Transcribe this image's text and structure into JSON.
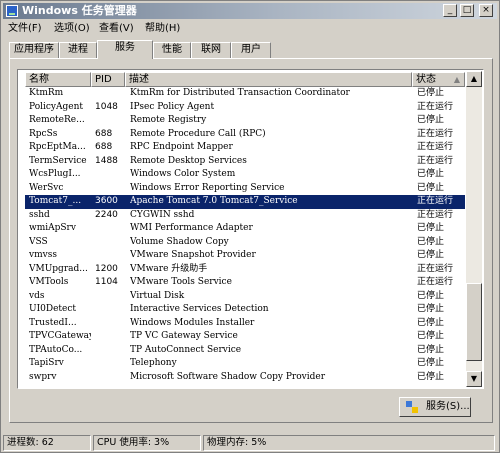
{
  "window": {
    "title": "Windows 任务管理器"
  },
  "titlebar_buttons": {
    "minimize": "_",
    "maximize": "□",
    "close": "×"
  },
  "menu": [
    "文件(F)",
    "选项(O)",
    "查看(V)",
    "帮助(H)"
  ],
  "tabs": [
    "应用程序",
    "进程",
    "服务",
    "性能",
    "联网",
    "用户"
  ],
  "active_tab": "服务",
  "columns": {
    "name": "名称",
    "pid": "PID",
    "desc": "描述",
    "status": "状态"
  },
  "rows": [
    {
      "name": "KtmRm",
      "pid": "",
      "desc": "KtmRm for Distributed Transaction Coordinator",
      "status": "已停止"
    },
    {
      "name": "PolicyAgent",
      "pid": "1048",
      "desc": "IPsec Policy Agent",
      "status": "正在运行"
    },
    {
      "name": "RemoteRe...",
      "pid": "",
      "desc": "Remote Registry",
      "status": "已停止"
    },
    {
      "name": "RpcSs",
      "pid": "688",
      "desc": "Remote Procedure Call (RPC)",
      "status": "正在运行"
    },
    {
      "name": "RpcEptMa...",
      "pid": "688",
      "desc": "RPC Endpoint Mapper",
      "status": "正在运行"
    },
    {
      "name": "TermService",
      "pid": "1488",
      "desc": "Remote Desktop Services",
      "status": "正在运行"
    },
    {
      "name": "WcsPlugI...",
      "pid": "",
      "desc": "Windows Color System",
      "status": "已停止"
    },
    {
      "name": "WerSvc",
      "pid": "",
      "desc": "Windows Error Reporting Service",
      "status": "已停止"
    },
    {
      "name": "Tomcat7_...",
      "pid": "3600",
      "desc": "Apache Tomcat 7.0 Tomcat7_Service",
      "status": "正在运行",
      "selected": true
    },
    {
      "name": "sshd",
      "pid": "2240",
      "desc": "CYGWIN sshd",
      "status": "正在运行"
    },
    {
      "name": "wmiApSrv",
      "pid": "",
      "desc": "WMI Performance Adapter",
      "status": "已停止"
    },
    {
      "name": "VSS",
      "pid": "",
      "desc": "Volume Shadow Copy",
      "status": "已停止"
    },
    {
      "name": "vmvss",
      "pid": "",
      "desc": "VMware Snapshot Provider",
      "status": "已停止"
    },
    {
      "name": "VMUpgrad...",
      "pid": "1200",
      "desc": "VMware 升级助手",
      "status": "正在运行"
    },
    {
      "name": "VMTools",
      "pid": "1104",
      "desc": "VMware Tools Service",
      "status": "正在运行"
    },
    {
      "name": "vds",
      "pid": "",
      "desc": "Virtual Disk",
      "status": "已停止"
    },
    {
      "name": "UI0Detect",
      "pid": "",
      "desc": "Interactive Services Detection",
      "status": "已停止"
    },
    {
      "name": "TrustedI...",
      "pid": "",
      "desc": "Windows Modules Installer",
      "status": "已停止"
    },
    {
      "name": "TPVCGateway",
      "pid": "",
      "desc": "TP VC Gateway Service",
      "status": "已停止"
    },
    {
      "name": "TPAutoCo...",
      "pid": "",
      "desc": "TP AutoConnect Service",
      "status": "已停止"
    },
    {
      "name": "TapiSrv",
      "pid": "",
      "desc": "Telephony",
      "status": "已停止"
    },
    {
      "name": "swprv",
      "pid": "",
      "desc": "Microsoft Software Shadow Copy Provider",
      "status": "已停止"
    }
  ],
  "services_button": "服务(S)...",
  "status": {
    "processes": "进程数: 62",
    "cpu": "CPU 使用率: 3%",
    "memory": "物理内存: 5%"
  },
  "colors": {
    "selection": "#0a246a",
    "face": "#d4d0c8"
  }
}
